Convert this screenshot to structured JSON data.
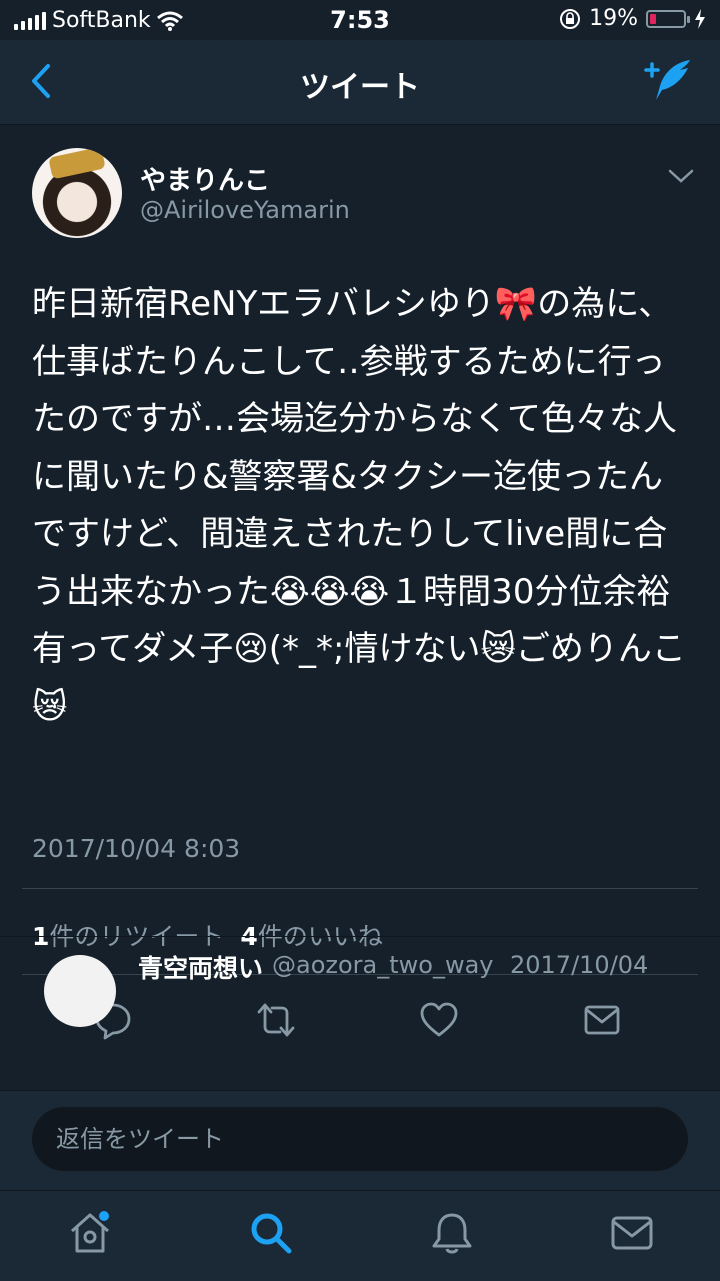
{
  "status_bar": {
    "carrier": "SoftBank",
    "time": "7:53",
    "battery_percent": "19%",
    "battery_level": 0.19,
    "battery_color": "#e0245e"
  },
  "nav": {
    "title": "ツイート",
    "back_icon": "chevron-left-icon",
    "compose_icon": "compose-tweet-icon",
    "accent_color": "#1da1f2"
  },
  "tweet": {
    "display_name": "やまりんこ",
    "handle": "@AiriloveYamarin",
    "text": "昨日新宿ReNYエラバレシゆり🎀の為に、仕事ばたりんこして‥参戦するために行ったのですが…会場迄分からなくて色々な人に聞いたり&警察署&タクシー迄使ったんですけど、間違えされたりしてlive間に合う出来なかった😭😭😭１時間30分位余裕有ってダメ子😢(*_*;情けない😿ごめりんこ😿",
    "timestamp": "2017/10/04 8:03",
    "retweet_count": "1",
    "retweet_label": "件のリツイート",
    "like_count": "4",
    "like_label": "件のいいね"
  },
  "actions": [
    "reply-icon",
    "retweet-icon",
    "like-icon",
    "direct-message-icon"
  ],
  "reply_preview": {
    "name": "青空両想い",
    "handle": "@aozora_two_way",
    "date": "2017/10/04"
  },
  "reply_box": {
    "placeholder": "返信をツイート"
  },
  "tab_bar": [
    "home-icon",
    "search-icon",
    "notifications-icon",
    "messages-icon"
  ]
}
